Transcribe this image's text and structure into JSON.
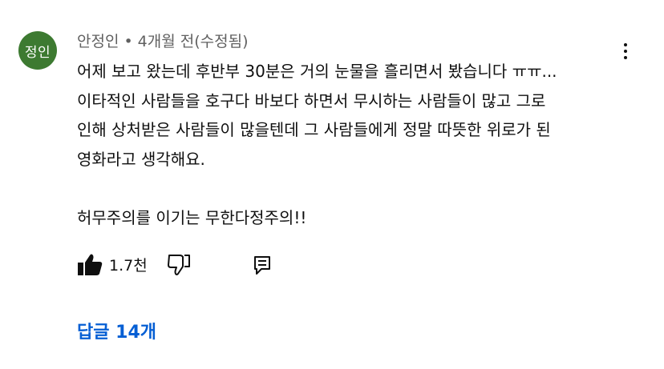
{
  "comment": {
    "avatar_text": "정인",
    "author": "안정인",
    "separator": "•",
    "time": "4개월 전(수정됨)",
    "body_lines": [
      "어제 보고 왔는데 후반부 30분은 거의 눈물을 흘리면서 봤습니다 ㅠㅠ...",
      "이타적인 사람들을 호구다 바보다 하면서 무시하는 사람들이 많고 그로",
      "인해 상처받은 사람들이 많을텐데 그 사람들에게 정말 따뜻한 위로가 된",
      "영화라고 생각해요.",
      "허무주의를 이기는 무한다정주의!!"
    ],
    "like_count": "1.7천",
    "replies_label": "답글 14개"
  },
  "icons": {
    "like": "thumbs-up-filled-icon",
    "dislike": "thumbs-down-outline-icon",
    "reply": "reply-comment-icon",
    "more": "vertical-ellipsis-icon"
  },
  "colors": {
    "avatar_bg": "#3d7a31",
    "link": "#065fd4",
    "meta_text": "#606060",
    "body_text": "#0f0f0f"
  }
}
